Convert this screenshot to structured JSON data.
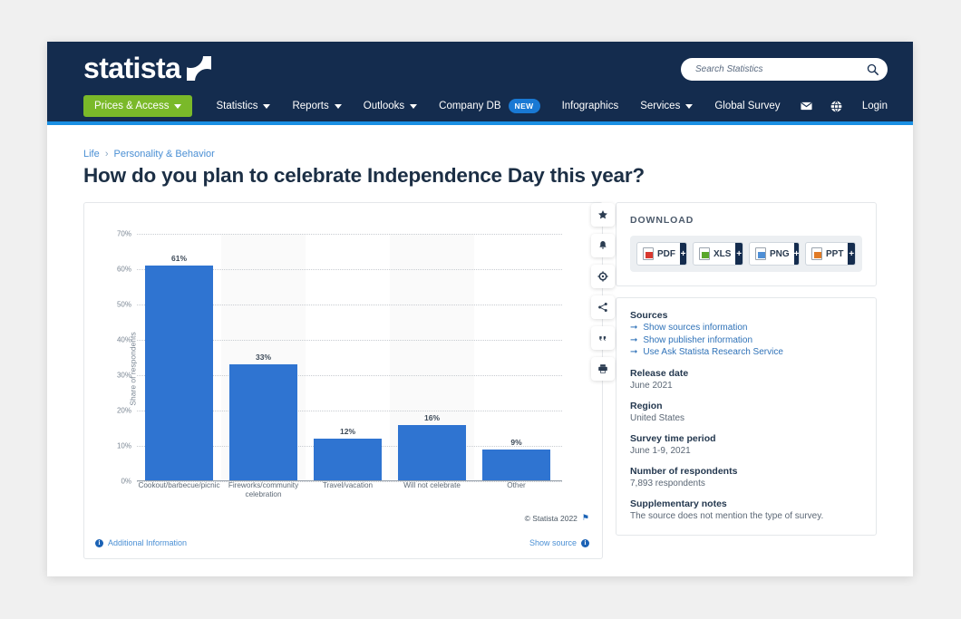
{
  "navbar": {
    "logo_text": "statista",
    "search": {
      "placeholder": "Search Statistics",
      "value": "",
      "icon": "search-icon"
    },
    "menu": [
      {
        "label": "Prices & Access",
        "caret": true,
        "primary": true
      },
      {
        "label": "Statistics",
        "caret": true
      },
      {
        "label": "Reports",
        "caret": true
      },
      {
        "label": "Outlooks",
        "caret": true
      },
      {
        "label": "Company DB",
        "badge": "NEW"
      },
      {
        "label": "Infographics"
      },
      {
        "label": "Services",
        "caret": true
      },
      {
        "label": "Global Survey"
      }
    ],
    "right": {
      "mail_icon": "envelope-icon",
      "globe_icon": "globe-icon",
      "login_label": "Login"
    }
  },
  "breadcrumb": {
    "root": "Life",
    "separator": "›",
    "current": "Personality & Behavior"
  },
  "page_title": "How do you plan to celebrate Independence Day this year?",
  "chart_tools": [
    {
      "name": "favorite-star-icon"
    },
    {
      "name": "notification-bell-icon"
    },
    {
      "name": "settings-gear-icon"
    },
    {
      "name": "share-icon"
    },
    {
      "name": "citation-quote-icon"
    },
    {
      "name": "print-icon"
    }
  ],
  "chart_footer": {
    "copyright": "© Statista 2022",
    "additional_information": "Additional Information",
    "show_source": "Show source",
    "info_glyph": "i"
  },
  "download": {
    "title": "DOWNLOAD",
    "buttons": [
      {
        "label": "PDF",
        "type": "pdf",
        "plus": "+"
      },
      {
        "label": "XLS",
        "type": "xls",
        "plus": "+"
      },
      {
        "label": "PNG",
        "type": "png",
        "plus": "+"
      },
      {
        "label": "PPT",
        "type": "ppt",
        "plus": "+"
      }
    ]
  },
  "details": {
    "sources_heading": "Sources",
    "source_links": [
      "Show sources information",
      "Show publisher information",
      "Use Ask Statista Research Service"
    ],
    "arrow_glyph": "➞",
    "fields": [
      {
        "label": "Release date",
        "value": "June 2021"
      },
      {
        "label": "Region",
        "value": "United States"
      },
      {
        "label": "Survey time period",
        "value": "June 1-9, 2021"
      },
      {
        "label": "Number of respondents",
        "value": "7,893 respondents"
      },
      {
        "label": "Supplementary notes",
        "value": "The source does not mention the type of survey."
      }
    ]
  },
  "chart_data": {
    "type": "bar",
    "title": "How do you plan to celebrate Independence Day this year?",
    "xlabel": "",
    "ylabel": "Share of respondents",
    "categories": [
      "Cookout/barbecue/picnic",
      "Fireworks/community celebration",
      "Travel/vacation",
      "Will not celebrate",
      "Other"
    ],
    "values": [
      61,
      33,
      12,
      16,
      9
    ],
    "value_labels": [
      "61%",
      "33%",
      "12%",
      "16%",
      "9%"
    ],
    "ylim": [
      0,
      70
    ],
    "yticks": [
      0,
      10,
      20,
      30,
      40,
      50,
      60,
      70
    ],
    "ytick_labels": [
      "0%",
      "10%",
      "20%",
      "30%",
      "40%",
      "50%",
      "60%",
      "70%"
    ],
    "grid": true,
    "legend": false,
    "bar_color": "#2f74d1"
  },
  "colors": {
    "navbar": "#142c4e",
    "accent_strip": "#1a8fe3",
    "primary_green": "#7ab929",
    "bar_blue": "#2f74d1",
    "link_blue": "#2f72b8",
    "page_bg": "#f0f0f0"
  }
}
